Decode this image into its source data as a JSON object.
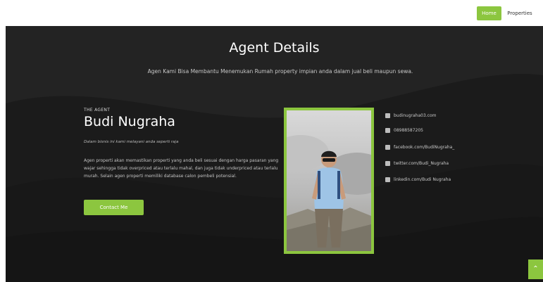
{
  "nav": {
    "home": "Home",
    "properties": "Properties"
  },
  "hero": {
    "title": "Agent Details",
    "subtitle": "Agen Kami Bisa Membantu Menemukan Rumah property impian anda dalam jual beli maupun sewa."
  },
  "agent": {
    "kicker": "THE AGENT",
    "name": "Budi Nugraha",
    "tagline": "Dalam bisnis ini kami melayani anda seperti raja",
    "description": "Agen properti akan memastikan properti yang anda beli sesuai dengan harga pasaran yang wajar sehingga tidak overpriced atau terlalu mahal, dan juga tidak underpriced atau terlalu murah. Selain agen properti memiliki database calon pembeli potensial.",
    "contact_button": "Contact Me"
  },
  "contacts": [
    {
      "icon": "envelope-icon",
      "text": "budinugraha03.com"
    },
    {
      "icon": "phone-icon",
      "text": "08988587205"
    },
    {
      "icon": "facebook-icon",
      "text": "facebook.com/BudiNugraha_"
    },
    {
      "icon": "twitter-icon",
      "text": "twitter.com/Budi_Nugraha"
    },
    {
      "icon": "linkedin-icon",
      "text": "linkedin.com/Budi Nugraha"
    }
  ],
  "colors": {
    "accent": "#8cc63f",
    "background": "#1d1d1d"
  },
  "scroll_top_icon": "chevron-up-icon"
}
